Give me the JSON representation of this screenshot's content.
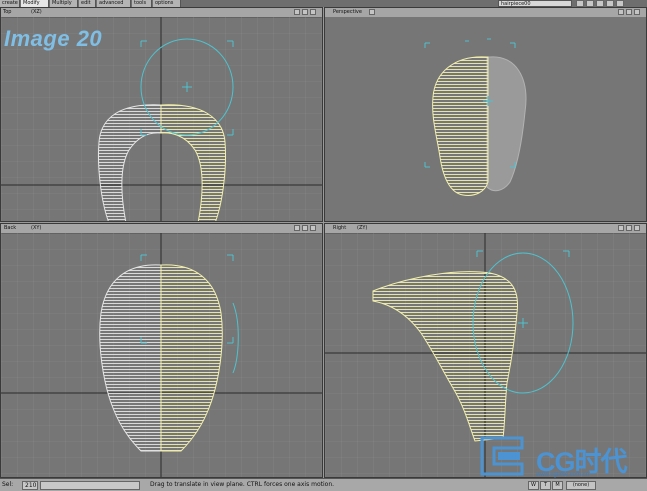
{
  "tabs": [
    {
      "label": "create"
    },
    {
      "label": "Modify",
      "active": true
    },
    {
      "label": "Multiply"
    },
    {
      "label": "edit"
    },
    {
      "label": "advanced"
    },
    {
      "label": "tools"
    },
    {
      "label": "options"
    }
  ],
  "object_selector": "hairpiece00",
  "watermark": "Image 20",
  "viewports": [
    {
      "name": "Top",
      "axes": "(XZ)"
    },
    {
      "name": "Perspective",
      "axes": ""
    },
    {
      "name": "Back",
      "axes": "(XY)"
    },
    {
      "name": "Right",
      "axes": "(ZY)"
    }
  ],
  "status": {
    "sel_label": "Sel:",
    "sel_value": "210",
    "message": "Drag to translate in view plane. CTRL forces one axis motion.",
    "buttons": [
      "W",
      "T",
      "M",
      "(none)"
    ]
  },
  "logo": {
    "text": "CG时代",
    "url": "www.cgtime.com.cn"
  },
  "colors": {
    "viewport_bg": "#767676",
    "grid": "#8a8a8a",
    "wire_selected": "#f3f0b0",
    "wire_unselected": "#e6e6e6",
    "gizmo": "#4ec3cf",
    "logo": "#4b93d3"
  }
}
